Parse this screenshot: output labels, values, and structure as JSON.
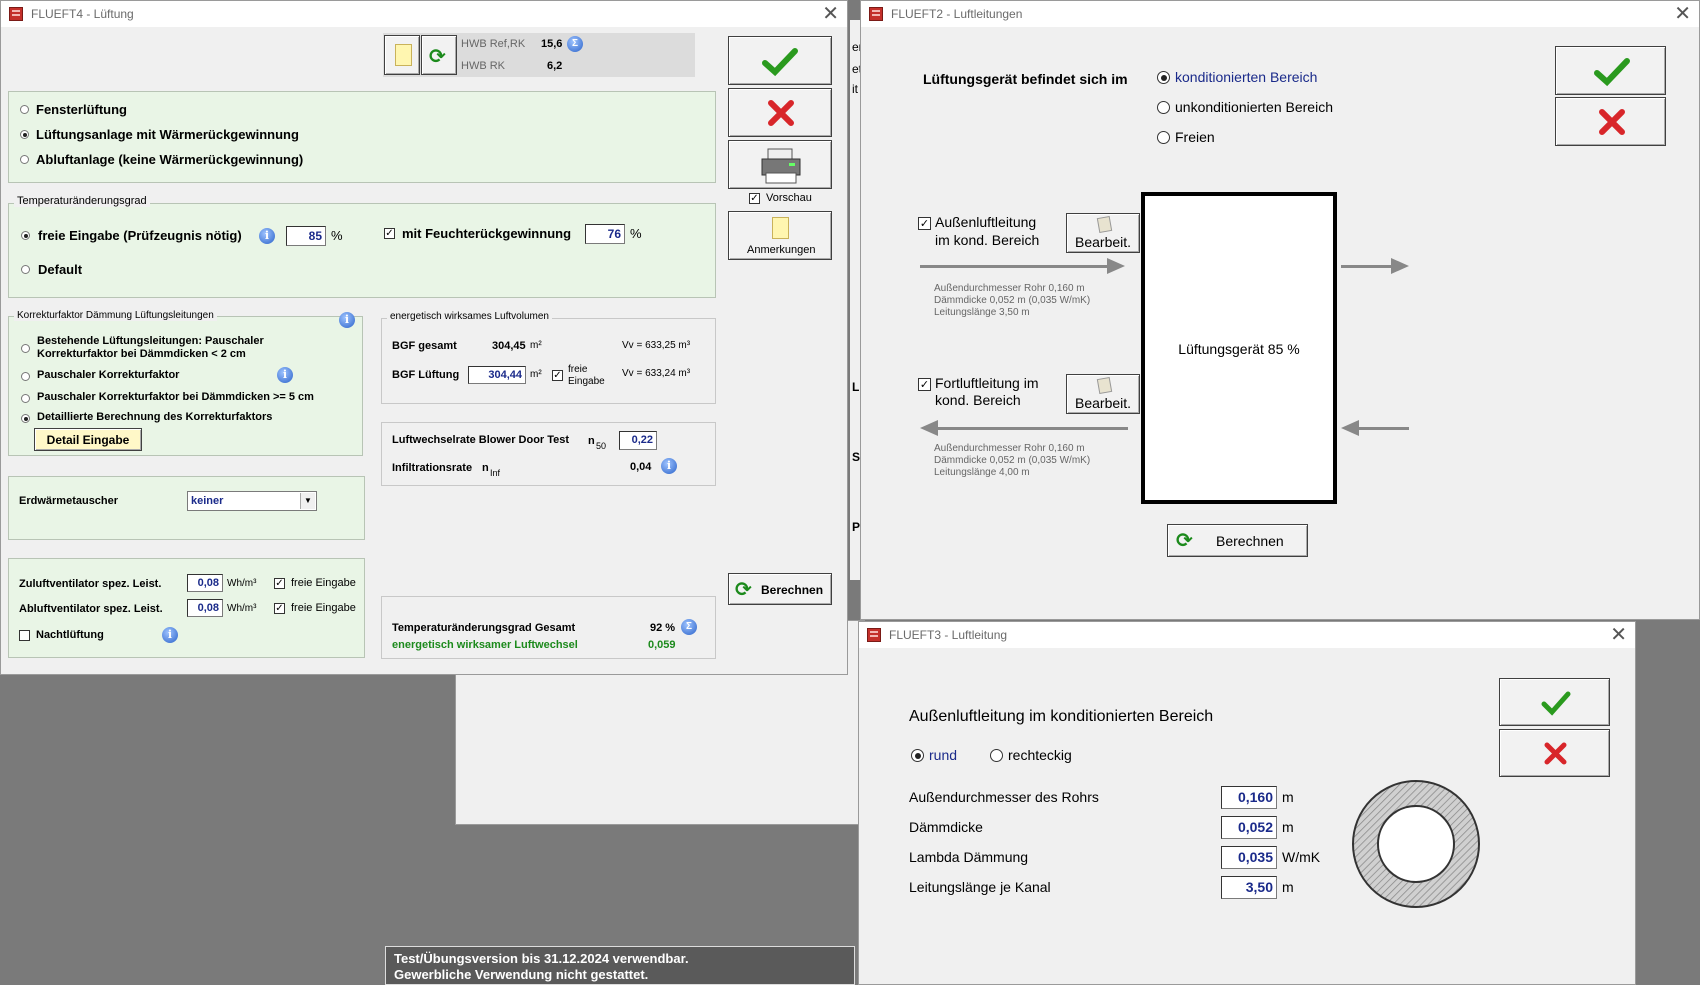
{
  "bg_window": {
    "t1": "er",
    "t2": "et",
    "t3": "it",
    "l1": "L",
    "l2": "S",
    "l3": "P"
  },
  "w4": {
    "title": "FLUEFT4 - Lüftung",
    "hwb_ref_label": "HWB Ref,RK",
    "hwb_ref_value": "15,6",
    "hwb_rk_label": "HWB RK",
    "hwb_rk_value": "6,2",
    "vent": {
      "opt1": "Fensterlüftung",
      "opt2": "Lüftungsanlage mit Wärmerückgewinnung",
      "opt3": "Abluftanlage (keine Wärmerückgewinnung)",
      "selected": 2
    },
    "temp": {
      "legend": "Temperaturänderungsgrad",
      "free_label": "freie Eingabe (Prüfzeugnis nötig)",
      "free_value": "85",
      "unit": "%",
      "default_label": "Default",
      "moist_label": "mit Feuchterückgewinnung",
      "moist_value": "76",
      "moist_unit": "%"
    },
    "korr": {
      "legend": "Korrekturfaktor Dämmung Lüftungsleitungen",
      "opt1a": "Bestehende Lüftungsleitungen: Pauschaler",
      "opt1b": "Korrekturfaktor bei Dämmdicken < 2 cm",
      "opt2": "Pauschaler Korrekturfaktor",
      "opt3": "Pauschaler Korrekturfaktor bei Dämmdicken >= 5 cm",
      "opt4": "Detaillierte Berechnung des Korrekturfaktors",
      "detail_btn": "Detail Eingabe"
    },
    "luftvol": {
      "legend": "energetisch wirksames Luftvolumen",
      "bgf_label": "BGF gesamt",
      "bgf_value": "304,45",
      "unit": "m²",
      "vv1": "Vv = 633,25 m³",
      "bgfl_label": "BGF Lüftung",
      "bgfl_value": "304,44",
      "free1": "freie",
      "free2": "Eingabe",
      "vv2": "Vv = 633,24 m³"
    },
    "blower": {
      "label": "Luftwechselrate Blower Door Test",
      "n": "n",
      "sub": "50",
      "value": "0,22",
      "inf_label": "Infiltrationsrate",
      "inf_n": "n",
      "inf_sub": "Inf",
      "inf_value": "0,04"
    },
    "erd": {
      "label": "Erdwärmetauscher",
      "value": "keiner"
    },
    "fans": {
      "zu_label": "Zuluftventilator spez. Leist.",
      "zu_value": "0,08",
      "zu_unit": "Wh/m³",
      "zu_free": "freie Eingabe",
      "ab_label": "Abluftventilator spez. Leist.",
      "ab_value": "0,08",
      "ab_unit": "Wh/m³",
      "ab_free": "freie Eingabe",
      "night": "Nachtlüftung"
    },
    "total": {
      "label": "Temperaturänderungsgrad Gesamt",
      "value": "92 %",
      "wirk_label": "energetisch wirksamer Luftwechsel",
      "wirk_value": "0,059"
    },
    "preview": "Vorschau",
    "notes": "Anmerkungen",
    "calc": "Berechnen"
  },
  "w2": {
    "title": "FLUEFT2 - Luftleitungen",
    "location_label": "Lüftungsgerät befindet sich im",
    "loc1": "konditionierten Bereich",
    "loc2": "unkonditionierten Bereich",
    "loc3": "Freien",
    "aussen_chk1": "Außenluftleitung",
    "aussen_chk2": "im kond. Bereich",
    "edit": "Bearbeit.",
    "aussen_info1": "Außendurchmesser Rohr 0,160 m",
    "aussen_info2": "Dämmdicke 0,052 m  (0,035 W/mK)",
    "aussen_info3": "Leitungslänge 3,50 m",
    "fort_chk1": "Fortluftleitung im",
    "fort_chk2": "kond. Bereich",
    "fort_info1": "Außendurchmesser Rohr 0,160 m",
    "fort_info2": "Dämmdicke 0,052 m  (0,035 W/mK)",
    "fort_info3": "Leitungslänge 4,00 m",
    "device": "Lüftungsgerät 85 %",
    "calc": "Berechnen"
  },
  "w3": {
    "title": "FLUEFT3 - Luftleitung",
    "heading": "Außenluftleitung im konditionierten Bereich",
    "round": "rund",
    "rect": "rechteckig",
    "rows": [
      {
        "label": "Außendurchmesser des Rohrs",
        "value": "0,160",
        "unit": "m"
      },
      {
        "label": "Dämmdicke",
        "value": "0,052",
        "unit": "m"
      },
      {
        "label": "Lambda Dämmung",
        "value": "0,035",
        "unit": "W/mK"
      },
      {
        "label": "Leitungslänge je Kanal",
        "value": "3,50",
        "unit": "m"
      }
    ]
  },
  "notice": {
    "line1": "Test/Übungsversion bis 31.12.2024 verwendbar.",
    "line2": "Gewerbliche Verwendung nicht gestattet."
  },
  "colors": {
    "panel_green": "#e9f5e6",
    "value_blue": "#1a2a8a",
    "ok_green": "#2a9a1e",
    "cancel_red": "#d8262a"
  }
}
